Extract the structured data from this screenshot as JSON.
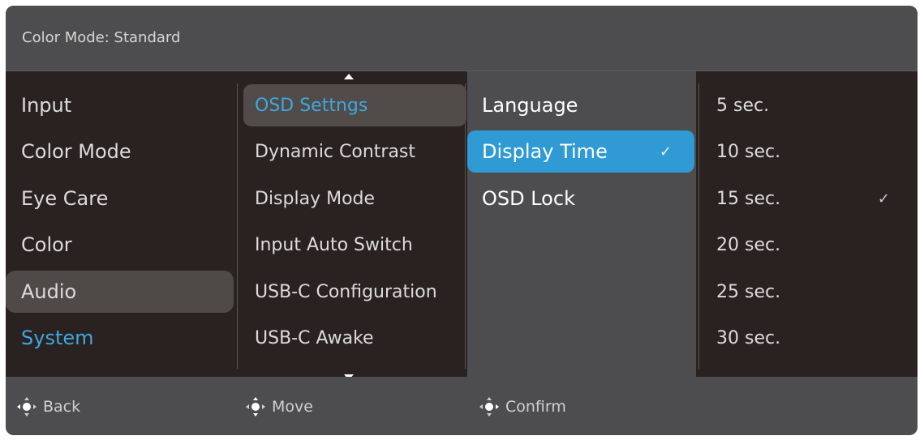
{
  "header": {
    "title": "Color Mode: Standard"
  },
  "menu": {
    "main": [
      {
        "label": "Input"
      },
      {
        "label": "Color Mode"
      },
      {
        "label": "Eye Care"
      },
      {
        "label": "Color"
      },
      {
        "label": "Audio"
      },
      {
        "label": "System"
      }
    ],
    "system": [
      {
        "label": "OSD Settngs"
      },
      {
        "label": "Dynamic Contrast"
      },
      {
        "label": "Display Mode"
      },
      {
        "label": "Input Auto Switch"
      },
      {
        "label": "USB-C Configuration"
      },
      {
        "label": "USB-C Awake"
      }
    ],
    "osd": [
      {
        "label": "Language"
      },
      {
        "label": "Display Time",
        "check": "✓"
      },
      {
        "label": "OSD Lock"
      }
    ],
    "display_time": [
      {
        "label": "5 sec."
      },
      {
        "label": "10 sec."
      },
      {
        "label": "15 sec.",
        "check": "✓"
      },
      {
        "label": "20 sec."
      },
      {
        "label": "25 sec."
      },
      {
        "label": "30 sec."
      }
    ]
  },
  "footer": {
    "back": "Back",
    "move": "Move",
    "confirm": "Confirm"
  },
  "colors": {
    "accent": "#3fa7e0",
    "highlight": "#2f9ad4",
    "panel": "#4d4d4f",
    "dark": "#2a2220"
  }
}
